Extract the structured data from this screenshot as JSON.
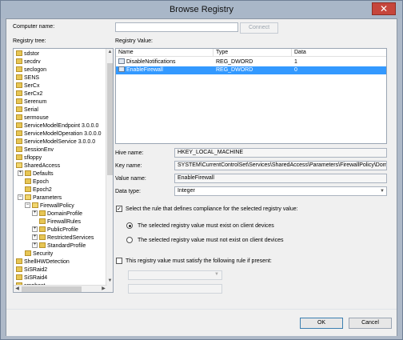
{
  "window": {
    "title": "Browse Registry"
  },
  "computer": {
    "label": "Computer name:",
    "value": "",
    "connect": "Connect"
  },
  "tree": {
    "label": "Registry tree:",
    "items": [
      {
        "label": "sdstor"
      },
      {
        "label": "secdrv"
      },
      {
        "label": "seclogon"
      },
      {
        "label": "SENS"
      },
      {
        "label": "SerCx"
      },
      {
        "label": "SerCx2"
      },
      {
        "label": "Serenum"
      },
      {
        "label": "Serial"
      },
      {
        "label": "sermouse"
      },
      {
        "label": "ServiceModelEndpoint 3.0.0.0"
      },
      {
        "label": "ServiceModelOperation 3.0.0.0"
      },
      {
        "label": "ServiceModelService 3.0.0.0"
      },
      {
        "label": "SessionEnv"
      },
      {
        "label": "sfloppy"
      },
      {
        "label": "SharedAccess"
      },
      {
        "label": "Defaults"
      },
      {
        "label": "Epoch"
      },
      {
        "label": "Epoch2"
      },
      {
        "label": "Parameters"
      },
      {
        "label": "FirewallPolicy"
      },
      {
        "label": "DomainProfile"
      },
      {
        "label": "FirewallRules"
      },
      {
        "label": "PublicProfile"
      },
      {
        "label": "RestrictedServices"
      },
      {
        "label": "StandardProfile"
      },
      {
        "label": "Security"
      },
      {
        "label": "ShellHWDetection"
      },
      {
        "label": "SiSRaid2"
      },
      {
        "label": "SiSRaid4"
      },
      {
        "label": "smphost"
      }
    ]
  },
  "registry_value": {
    "label": "Registry Value:",
    "columns": [
      "Name",
      "Type",
      "Data"
    ],
    "rows": [
      {
        "name": "DisableNotifications",
        "type": "REG_DWORD",
        "data": "1"
      },
      {
        "name": "EnableFirewall",
        "type": "REG_DWORD",
        "data": "0"
      }
    ]
  },
  "details": {
    "hive_label": "Hive name:",
    "hive_value": "HKEY_LOCAL_MACHINE",
    "key_label": "Key name:",
    "key_value": "SYSTEM\\CurrentControlSet\\Services\\SharedAccess\\Parameters\\FirewallPolicy\\Dom",
    "value_label": "Value name:",
    "value_value": "EnableFirewall",
    "datatype_label": "Data type:",
    "datatype_value": "Integer"
  },
  "rule": {
    "select_label": "Select the rule that defines compliance for the selected registry value:",
    "option_exist": "The selected registry value must exist on client devices",
    "option_not_exist": "The selected registry value must not exist on client devices",
    "satisfy_label": "This registry value must satisfy the following rule if present:"
  },
  "footer": {
    "ok": "OK",
    "cancel": "Cancel"
  }
}
